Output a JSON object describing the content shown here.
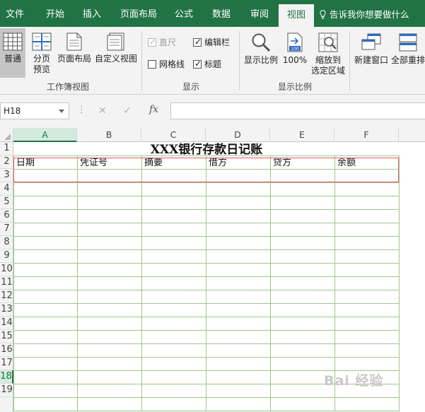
{
  "tabs": [
    {
      "label": "文件"
    },
    {
      "label": "开始"
    },
    {
      "label": "插入"
    },
    {
      "label": "页面布局"
    },
    {
      "label": "公式"
    },
    {
      "label": "数据"
    },
    {
      "label": "审阅"
    },
    {
      "label": "视图",
      "active": true
    }
  ],
  "tell_me": "告诉我你想要做什么",
  "ribbon": {
    "workbook_views": {
      "label": "工作簿视图",
      "normal": "普通",
      "page_break_line1": "分页",
      "page_break_line2": "预览",
      "page_layout": "页面布局",
      "custom_views": "自定义视图"
    },
    "show": {
      "label": "显示",
      "ruler": "直尺",
      "formula_bar": "编辑栏",
      "gridlines": "网格线",
      "headings": "标题"
    },
    "zoom": {
      "label": "显示比例",
      "zoom": "显示比例",
      "hundred": "100%",
      "hundred_badge": "100",
      "to_selection_line1": "缩放到",
      "to_selection_line2": "选定区域"
    },
    "window": {
      "new_window": "新建窗口",
      "arrange_all": "全部重排"
    }
  },
  "formula_bar": {
    "name_box": "H18",
    "dots": "⋮",
    "cancel": "✕",
    "enter": "✓",
    "fx": "fx",
    "value": ""
  },
  "sheet": {
    "columns": [
      "A",
      "B",
      "C",
      "D",
      "E",
      "F"
    ],
    "rows": [
      "1",
      "2",
      "3",
      "4",
      "5",
      "6",
      "7",
      "8",
      "9",
      "10",
      "11",
      "12",
      "13",
      "14",
      "15",
      "16",
      "17",
      "18",
      "19"
    ],
    "selected_row": "18",
    "selected_col": "A",
    "title": "XXX银行存款日记账",
    "headers": [
      "日期",
      "凭证号",
      "摘要",
      "借方",
      "贷方",
      "余额"
    ]
  },
  "watermark": "Bai 经验",
  "colors": {
    "excel_green": "#217346",
    "table_border": "#9dc78a",
    "highlight_red": "#e05a5a"
  }
}
